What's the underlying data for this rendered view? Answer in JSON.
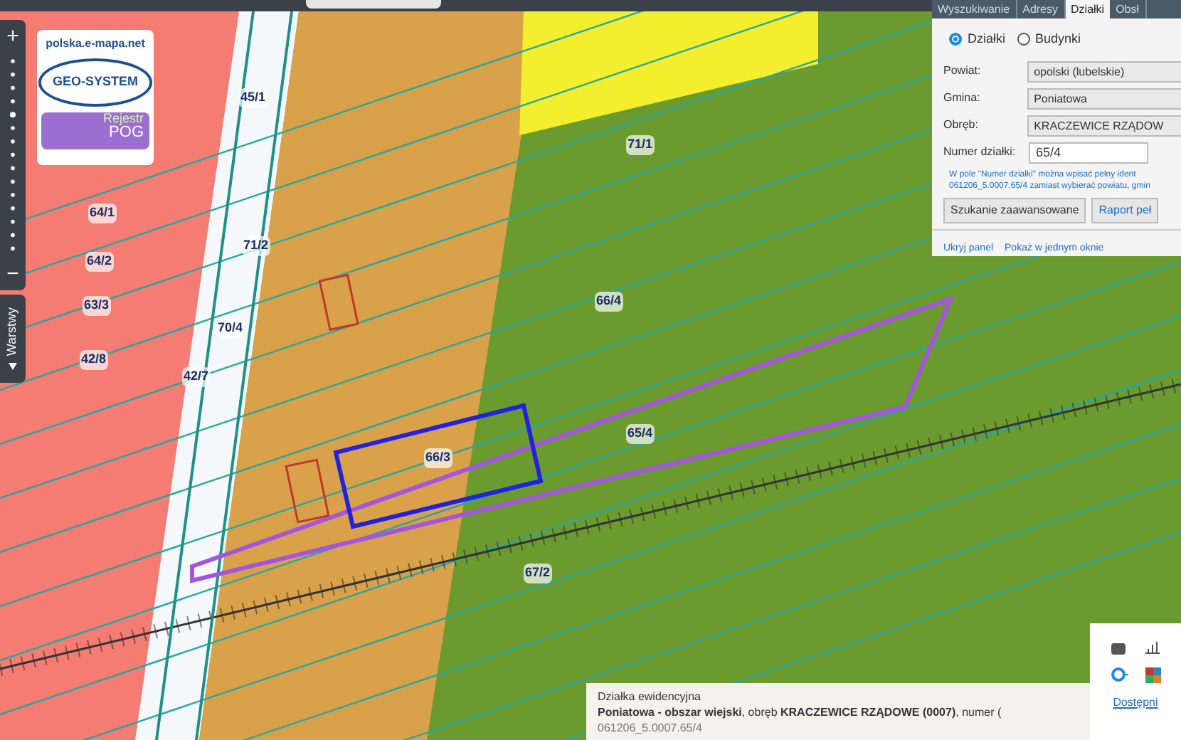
{
  "logo": {
    "url": "polska.e-mapa.net",
    "name": "GEO-SYSTEM",
    "badge_line_1": "Rejestr",
    "badge_line_2": "POG"
  },
  "zoom_bar": {
    "zoom_in": "+",
    "zoom_out": "−",
    "layers_tab": "Warstwy"
  },
  "map_labels": [
    "64/1",
    "64/2",
    "63/3",
    "42/8",
    "45/1",
    "71/2",
    "70/4",
    "42/7",
    "71/1",
    "66/4",
    "65/4",
    "66/3",
    "67/2"
  ],
  "search_panel": {
    "tabs": [
      {
        "label": "Wyszukiwanie",
        "selected": false
      },
      {
        "label": "Adresy",
        "selected": false
      },
      {
        "label": "Działki",
        "selected": true
      },
      {
        "label": "Obsł",
        "selected": false
      }
    ],
    "radios": [
      {
        "label": "Działki",
        "selected": true
      },
      {
        "label": "Budynki",
        "selected": false
      }
    ],
    "fields": [
      {
        "label": "Powiat:",
        "value": "opolski (lubelskie)",
        "kind": "select"
      },
      {
        "label": "Gmina:",
        "value": "Poniatowa",
        "kind": "select"
      },
      {
        "label": "Obręb:",
        "value": "KRACZEWICE RZĄDOW",
        "kind": "select"
      },
      {
        "label": "Numer działki:",
        "value": "65/4",
        "kind": "input"
      }
    ],
    "hint": "W pole \"Numer działki\" można wpisać pełny ident 061206_5.0007.65/4 zamiast wybierać powiatu, gmin",
    "buttons": [
      "Szukanie zaawansowane",
      "Raport peł"
    ],
    "links": [
      "Ukryj panel",
      "Pokaż w jednym oknie"
    ]
  },
  "info_panel": {
    "title": "Działka ewidencyjna",
    "description": "**Poniatowa - obszar wiejski**, obręb **KRACZEWICE RZĄDOWE (0007)**, numer (",
    "identifier": "061206_5.0007.65/4"
  },
  "side_panel": {
    "link": "Dostępni"
  }
}
